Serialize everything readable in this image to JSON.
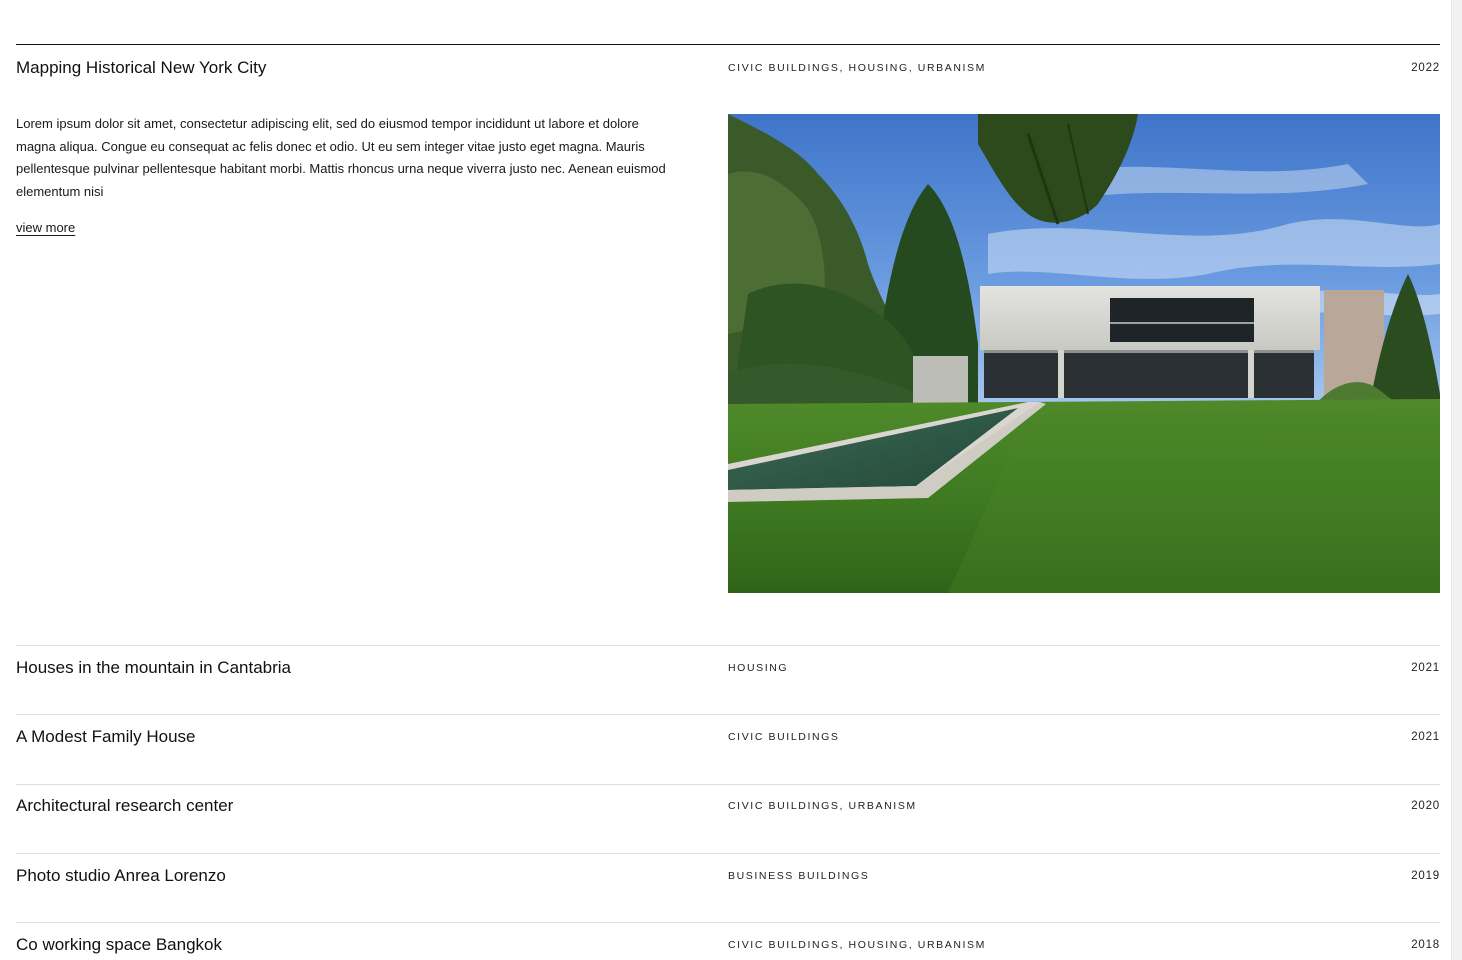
{
  "featured": {
    "title": "Mapping Historical New York City",
    "tags": "CIVIC BUILDINGS, HOUSING, URBANISM",
    "year": "2022",
    "description": "Lorem ipsum dolor sit amet, consectetur adipiscing elit, sed do eiusmod tempor incididunt ut labore et dolore magna aliqua. Congue eu consequat ac felis donec et odio. Ut eu sem integer vitae justo eget magna. Mauris pellentesque pulvinar pellentesque habitant morbi. Mattis rhoncus urna neque viverra justo nec. Aenean euismod elementum nisi",
    "view_more_label": "view more",
    "image_subject": "modern-concrete-house-with-pool-and-lawn"
  },
  "projects": [
    {
      "title": "Houses in the mountain in Cantabria",
      "tags": "HOUSING",
      "year": "2021"
    },
    {
      "title": "A Modest Family House",
      "tags": "CIVIC BUILDINGS",
      "year": "2021"
    },
    {
      "title": "Architectural research center",
      "tags": "CIVIC BUILDINGS, URBANISM",
      "year": "2020"
    },
    {
      "title": "Photo studio Anrea Lorenzo",
      "tags": "BUSINESS BUILDINGS",
      "year": "2019"
    },
    {
      "title": "Co working space Bangkok",
      "tags": "CIVIC BUILDINGS, HOUSING, URBANISM",
      "year": "2018"
    }
  ],
  "colors": {
    "text": "#111111",
    "divider": "#dddddd",
    "background": "#ffffff"
  }
}
